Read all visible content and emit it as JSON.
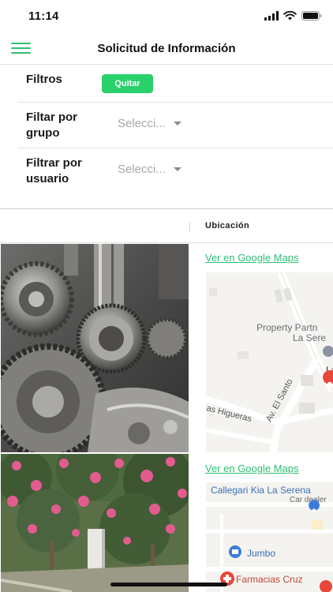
{
  "status": {
    "time": "11:14"
  },
  "nav": {
    "title": "Solicitud de Información"
  },
  "filters": {
    "label": "Filtros",
    "clear_button": "Quitar",
    "group": {
      "label": "Filtar por grupo",
      "placeholder": "Selecci..."
    },
    "user": {
      "label": "Filtrar por usuario",
      "placeholder": "Selecci..."
    }
  },
  "table": {
    "columns": [
      "",
      "Ubicación"
    ],
    "rows": [
      {
        "link": "Ver en Google Maps",
        "map_labels": {
          "poi": "Property Partn",
          "poi_city": "La Sere",
          "street1": "Av. El Santo",
          "street2": "as Higueras",
          "cut": "La"
        }
      },
      {
        "link": "Ver en Google Maps",
        "map_labels": {
          "poi1": "Callegari Kia La Serena",
          "poi1_sub": "Car dealer",
          "poi2": "Jumbo",
          "poi3": "Farmacias Cruz"
        }
      }
    ]
  },
  "colors": {
    "accent": "#29d16b",
    "link": "#2fbf73",
    "placeholder": "#a8a8a8",
    "pin_red": "#e8463a",
    "pin_blue": "#3e7bd8"
  }
}
